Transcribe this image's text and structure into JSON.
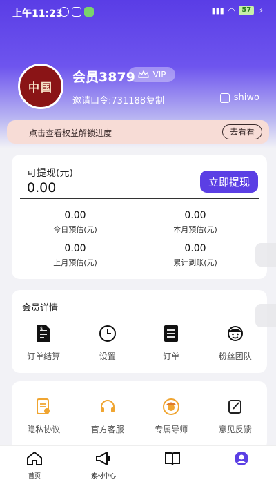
{
  "status_bar": {
    "time": "上午11:23",
    "battery": "57"
  },
  "profile": {
    "avatar_text": "中国",
    "member_name": "会员3879",
    "vip_label": "VIP",
    "invite_code": "邀请口令:731188",
    "copy_label": "复制",
    "username": "shiwo"
  },
  "unlock_banner": {
    "text": "点击查看权益解锁进度",
    "button": "去看看"
  },
  "earnings": {
    "withdrawable_label": "可提现(元)",
    "withdrawable_value": "0.00",
    "withdraw_button": "立即提现",
    "stats": [
      {
        "value": "0.00",
        "label": "今日预估(元)"
      },
      {
        "value": "0.00",
        "label": "本月预估(元)"
      },
      {
        "value": "0.00",
        "label": "上月预估(元)"
      },
      {
        "value": "0.00",
        "label": "累计到账(元)"
      }
    ]
  },
  "member_details": {
    "title": "会员详情",
    "items": [
      {
        "label": "订单结算",
        "icon": "invoice-icon"
      },
      {
        "label": "设置",
        "icon": "clock-icon"
      },
      {
        "label": "订单",
        "icon": "document-icon"
      },
      {
        "label": "粉丝团队",
        "icon": "fan-face-icon"
      }
    ]
  },
  "services": {
    "items": [
      {
        "label": "隐私协议",
        "icon": "privacy-doc-icon"
      },
      {
        "label": "官方客服",
        "icon": "headset-icon"
      },
      {
        "label": "专属导师",
        "icon": "mentor-icon"
      },
      {
        "label": "意见反馈",
        "icon": "feedback-edit-icon"
      }
    ]
  },
  "tab_bar": {
    "tabs": [
      {
        "label": "首页",
        "icon": "home-icon"
      },
      {
        "label": "素材中心",
        "icon": "megaphone-icon"
      },
      {
        "label": "",
        "icon": "book-icon"
      },
      {
        "label": "",
        "icon": "profile-icon"
      }
    ]
  },
  "colors": {
    "primary": "#5b3fe4",
    "banner": "#f7dcd6",
    "icon_orange": "#f0a531"
  }
}
